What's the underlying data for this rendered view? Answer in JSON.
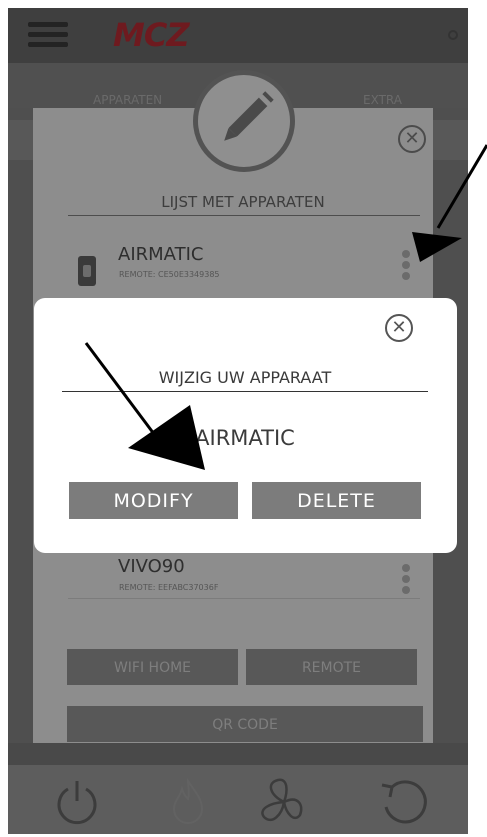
{
  "header": {
    "logo_text": "MCZ"
  },
  "background_tabs": {
    "left_hint": "APPARATEN",
    "right_hint": "EXTRA"
  },
  "device_list_panel": {
    "title": "LIJST MET APPARATEN",
    "devices": [
      {
        "name": "AIRMATIC",
        "remote": "REMOTE: CE50E3349385"
      },
      {
        "name": "VIVO90",
        "remote": "REMOTE: EEFABC37036F"
      }
    ],
    "buttons": {
      "wifi_home": "WIFI HOME",
      "remote": "REMOTE",
      "qr_code": "QR CODE"
    }
  },
  "modal": {
    "title": "WIJZIG UW APPARAAT",
    "device_name": "AIRMATIC",
    "modify_label": "MODIFY",
    "delete_label": "DELETE"
  },
  "colors": {
    "logo": "#6e1a1f",
    "modal_button": "#7c7c7c",
    "overlay_panel": "#8d8d8d"
  },
  "icons": [
    "menu-icon",
    "pencil-icon",
    "close-icon",
    "kebab-menu-icon",
    "power-icon",
    "flame-icon",
    "fan-icon",
    "refresh-icon"
  ]
}
